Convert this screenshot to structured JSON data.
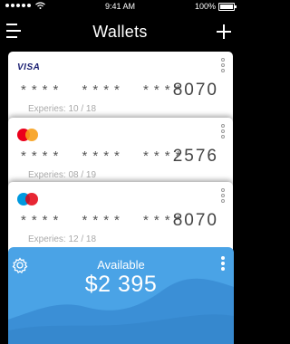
{
  "status": {
    "time": "9:41 AM",
    "battery": "100%"
  },
  "header": {
    "title": "Wallets"
  },
  "cards": [
    {
      "brand": "VISA",
      "mask": "**** **** ****",
      "last4": "8070",
      "expiry": "Experies: 10 / 18"
    },
    {
      "brand": "mastercard",
      "mask": "**** **** ****",
      "last4": "2576",
      "expiry": "Experies: 08 / 19"
    },
    {
      "brand": "maestro",
      "mask": "**** **** ****",
      "last4": "8070",
      "expiry": "Experies: 12 / 18"
    }
  ],
  "wallet": {
    "label": "Available",
    "amount": "$2 395"
  },
  "colors": {
    "wallet": "#4aa3e6",
    "wallet_wave": "#3b8fd6"
  }
}
